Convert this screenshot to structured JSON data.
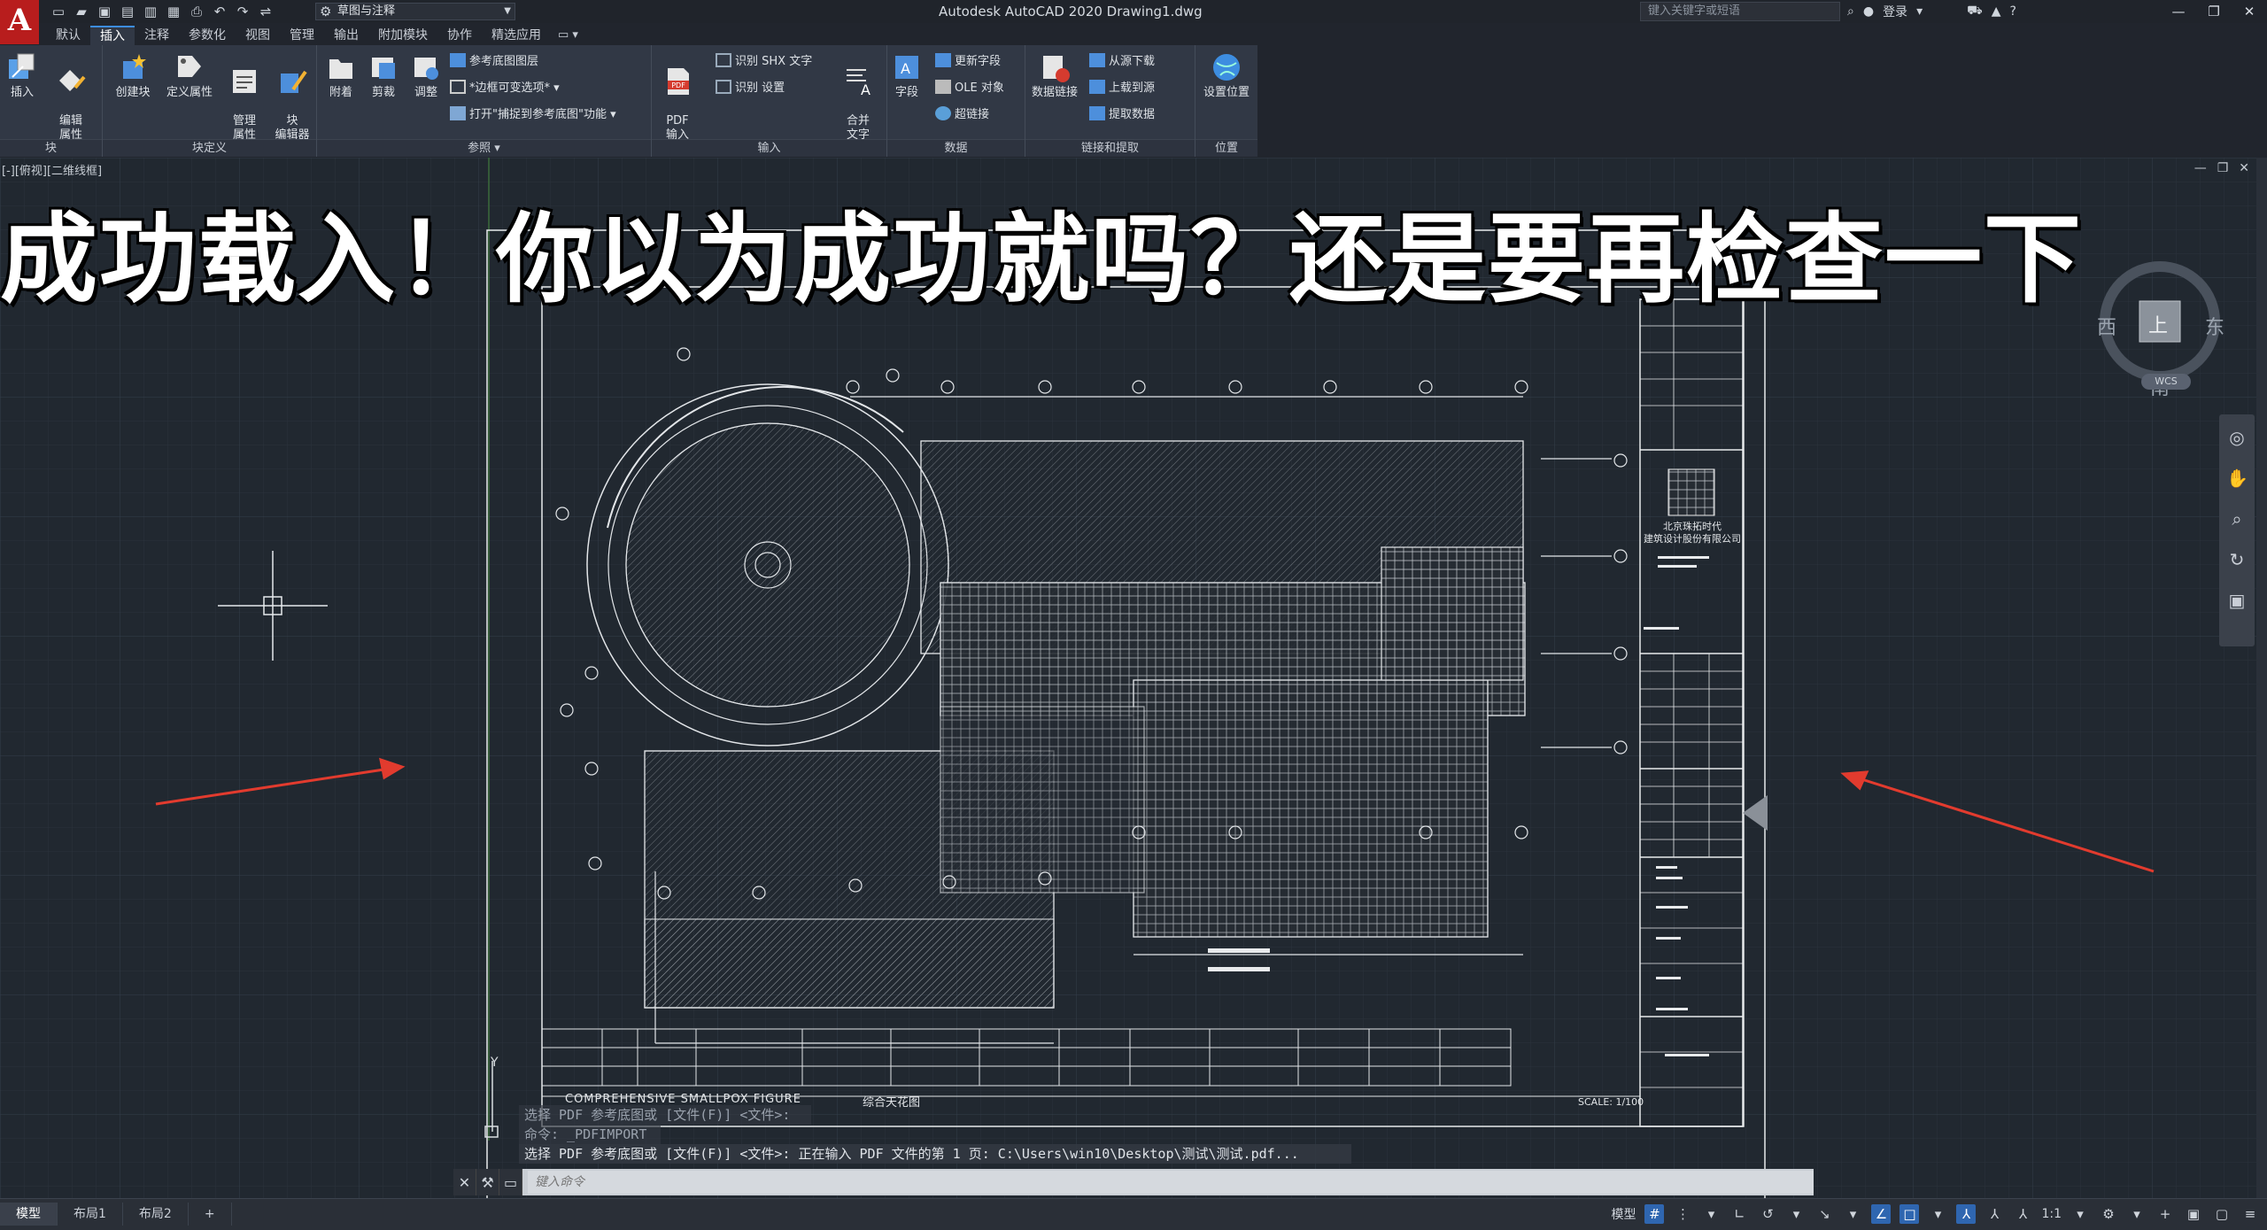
{
  "title_bar": {
    "app_logo": "A",
    "workspace": "草图与注释",
    "document_title": "Autodesk AutoCAD 2020    Drawing1.dwg",
    "search_placeholder": "键入关键字或短语",
    "sign_in": "登录"
  },
  "ribbon_tabs": [
    "默认",
    "插入",
    "注释",
    "参数化",
    "视图",
    "管理",
    "输出",
    "附加模块",
    "协作",
    "精选应用"
  ],
  "active_tab": "插入",
  "ribbon": {
    "panels": [
      {
        "title": "块",
        "tools": [
          "插入",
          "编辑\n属性"
        ]
      },
      {
        "title": "块定义",
        "tools": [
          "创建块",
          "定义属性",
          "管理\n属性",
          "块\n编辑器"
        ]
      },
      {
        "title": "参照",
        "tools": [
          "附着",
          "剪裁",
          "调整"
        ],
        "small": [
          "参考底图图层",
          "*边框可变选项*",
          "打开\"捕捉到参考底图\"功能"
        ]
      },
      {
        "title": "输入",
        "tools": [
          "PDF\n输入"
        ],
        "small": [
          "识别 SHX 文字",
          "识别 设置"
        ]
      },
      {
        "title": "数据",
        "tools": [
          "合并\n文字",
          "字段"
        ],
        "small": [
          "更新字段",
          "OLE 对象",
          "超链接"
        ]
      },
      {
        "title": "链接和提取",
        "tools": [
          "数据链接"
        ],
        "small": [
          "从源下载",
          "上载到源",
          "提取数据"
        ]
      },
      {
        "title": "位置",
        "tools": [
          "设置位置"
        ]
      }
    ]
  },
  "viewport_label": "[-][俯视][二维线框]",
  "overlay_caption": "成功载入！你以为成功就吗？还是要再检查一下",
  "viewcube": {
    "west": "西",
    "east": "东",
    "south": "南",
    "top": "上",
    "wcs": "WCS"
  },
  "drawing_sheet": {
    "title_en": "COMPREHENSIVE SMALLPOX FIGURE",
    "title_cn": "综合天花图",
    "scale": "SCALE: 1/100",
    "company": "北京珠拓时代\n建筑设计股份有限公司",
    "axis_y": "Y"
  },
  "command_history": [
    "选择 PDF 参考底图或 [文件(F)] <文件>:",
    "命令: _PDFIMPORT",
    "选择 PDF 参考底图或 [文件(F)] <文件>: 正在输入 PDF 文件的第 1 页: C:\\Users\\win10\\Desktop\\测试\\测试.pdf..."
  ],
  "command_placeholder": "键入命令",
  "layout_tabs": [
    "模型",
    "布局1",
    "布局2"
  ],
  "active_layout": "模型",
  "status_bar": {
    "model_label": "模型",
    "scale": "1:1"
  },
  "colors": {
    "accent": "#3d8de0",
    "app_red": "#b81d1d",
    "annotation_arrow": "#e23b2e"
  }
}
